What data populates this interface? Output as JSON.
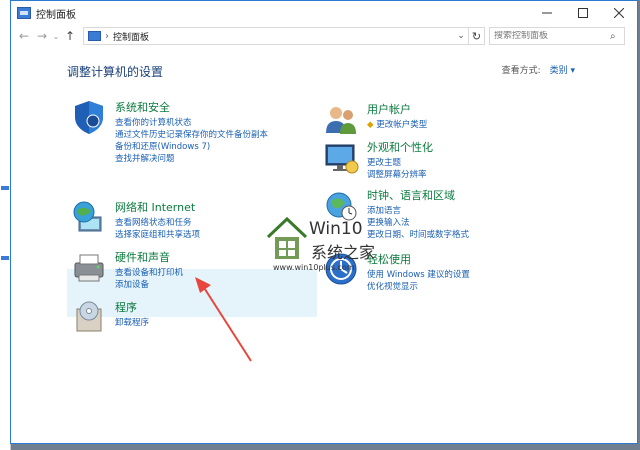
{
  "window": {
    "title": "控制面板",
    "address_crumb": "控制面板",
    "search_placeholder": "搜索控制面板"
  },
  "header": {
    "heading": "调整计算机的设置",
    "view_label": "查看方式:",
    "view_value": "类别"
  },
  "categories_left": [
    {
      "title": "系统和安全",
      "links": [
        "查看你的计算机状态",
        "通过文件历史记录保存你的文件备份副本",
        "备份和还原(Windows 7)",
        "查找并解决问题"
      ]
    },
    {
      "title": "网络和 Internet",
      "links": [
        "查看网络状态和任务",
        "选择家庭组和共享选项"
      ]
    },
    {
      "title": "硬件和声音",
      "links": [
        "查看设备和打印机",
        "添加设备"
      ]
    },
    {
      "title": "程序",
      "links": [
        "卸载程序"
      ]
    }
  ],
  "categories_right": [
    {
      "title": "用户帐户",
      "links": [
        "更改帐户类型"
      ]
    },
    {
      "title": "外观和个性化",
      "links": [
        "更改主题",
        "调整屏幕分辨率"
      ]
    },
    {
      "title": "时钟、语言和区域",
      "links": [
        "添加语言",
        "更换输入法",
        "更改日期、时间或数字格式"
      ]
    },
    {
      "title": "轻松使用",
      "links": [
        "使用 Windows 建议的设置",
        "优化视觉显示"
      ]
    }
  ],
  "watermark": {
    "title": "Win10",
    "subtitle": "系统之家",
    "url": "www.win10plus.com"
  },
  "colors": {
    "category_title": "#0b7a3e",
    "link": "#1a5fb4",
    "highlight": "#e5f3fb",
    "arrow": "#e8463c"
  }
}
